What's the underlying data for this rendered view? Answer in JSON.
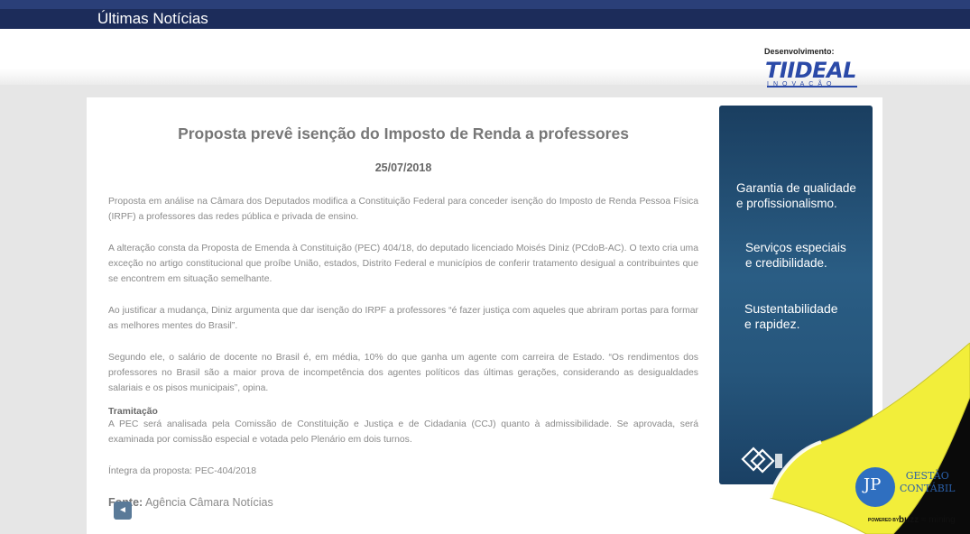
{
  "topbar": {
    "title": "Últimas Notícias"
  },
  "header": {
    "dev_label": "Desenvolvimento:",
    "logo_main": "TIIDEAL",
    "logo_sub": "INOVAÇÃO"
  },
  "article": {
    "title": "Proposta prevê isenção do Imposto de Renda a professores",
    "date": "25/07/2018",
    "paragraphs": [
      "Proposta em análise na Câmara dos Deputados modifica a Constituição Federal para conceder isenção do Imposto de Renda Pessoa Física (IRPF) a professores das redes pública e privada de ensino.",
      "A alteração consta da Proposta de Emenda à Constituição (PEC) 404/18, do deputado licenciado Moisés Diniz (PCdoB-AC). O texto cria uma exceção no artigo constitucional que proíbe União, estados, Distrito Federal e municípios de conferir tratamento desigual a contribuintes que se encontrem em situação semelhante.",
      "Ao justificar a mudança, Diniz argumenta que dar isenção do IRPF a professores “é fazer justiça com aqueles que abriram portas para formar as melhores mentes do Brasil”.",
      "Segundo ele, o salário de docente no Brasil é, em média, 10% do que ganha um agente com carreira de Estado. “Os rendimentos dos professores no Brasil são a maior prova de incompetência dos agentes políticos das últimas gerações, considerando as desigualdades salariais e os pisos municipais”, opina."
    ],
    "subhead": "Tramitação",
    "tramitacao": "A PEC será analisada pela Comissão de Constituição e Justiça e de Cidadania (CCJ) quanto à admissibilidade. Se aprovada, será examinada por comissão especial e votada pelo Plenário em dois turnos.",
    "integra": "Íntegra da proposta: PEC-404/2018",
    "source_label": "Fonte:",
    "source_value": " Agência Câmara Notícias",
    "back_label": "◄"
  },
  "ad": {
    "line1a": "Garantia de qualidade",
    "line1b": "e profissionalismo.",
    "line2a": "Serviços especiais",
    "line2b": "e credibilidade.",
    "line3a": "Sustentabilidade",
    "line3b": "e rapidez."
  },
  "brand": {
    "initials": "JP",
    "name1": "GESTÃO",
    "name2": "CONTÁBIL",
    "powered": "POWERED BY",
    "buzz": "buzz",
    "mining": "mining"
  },
  "colors": {
    "topbar": "#1c2c5a",
    "accent": "#2b4aa8",
    "curl": "#f2ee3a"
  }
}
